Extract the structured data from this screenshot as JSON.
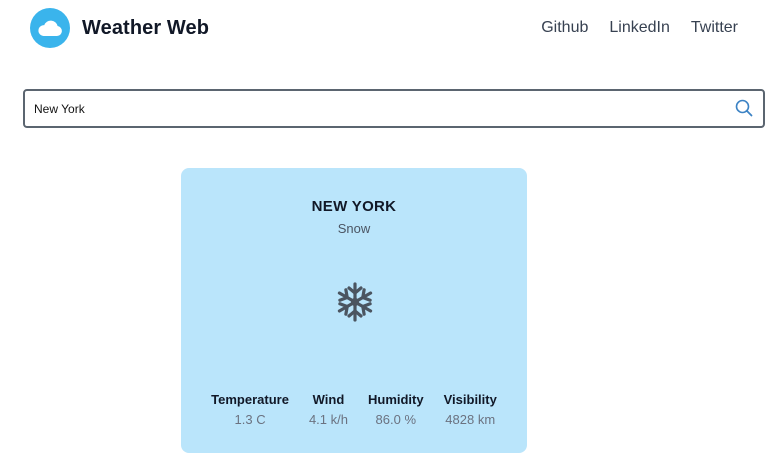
{
  "header": {
    "brand": "Weather Web",
    "logo_icon": "cloud-icon",
    "nav": [
      {
        "label": "Github"
      },
      {
        "label": "LinkedIn"
      },
      {
        "label": "Twitter"
      }
    ]
  },
  "search": {
    "value": "New York",
    "icon": "search-icon"
  },
  "weather": {
    "city": "NEW YORK",
    "condition": "Snow",
    "icon": "snowflake-icon",
    "stats": [
      {
        "label": "Temperature",
        "value": "1.3 C"
      },
      {
        "label": "Wind",
        "value": "4.1 k/h"
      },
      {
        "label": "Humidity",
        "value": "86.0 %"
      },
      {
        "label": "Visibility",
        "value": "4828 km"
      }
    ]
  },
  "colors": {
    "accent": "#3ab4ec",
    "card_background": "#bae5fb",
    "search_border": "#5b6570"
  }
}
